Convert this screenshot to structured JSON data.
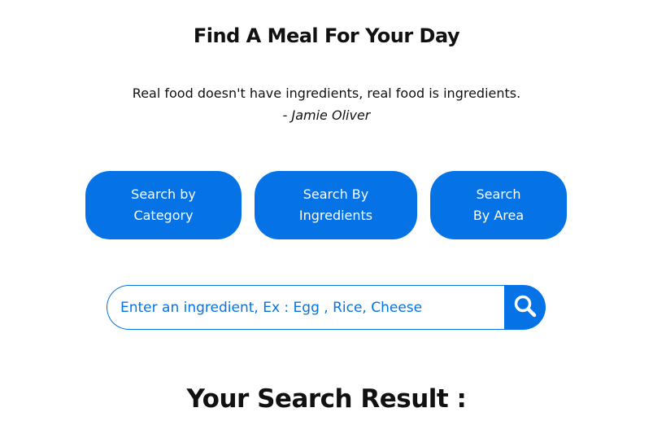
{
  "header": {
    "title": "Find A Meal For Your Day"
  },
  "quote": {
    "text": "Real food doesn't have ingredients, real food is ingredients.",
    "dash": "- ",
    "author": "Jamie Oliver"
  },
  "search_modes": [
    {
      "line1": "Search by",
      "line2": "Category"
    },
    {
      "line1": "Search By",
      "line2": "Ingredients"
    },
    {
      "line1": "Search",
      "line2": "By Area"
    }
  ],
  "search": {
    "placeholder": "Enter an ingredient, Ex : Egg , Rice, Cheese",
    "value": "",
    "button_icon": "search-icon"
  },
  "results": {
    "heading": "Your Search Result :"
  },
  "colors": {
    "accent": "#0573e6",
    "text": "#111111",
    "background": "#ffffff"
  }
}
